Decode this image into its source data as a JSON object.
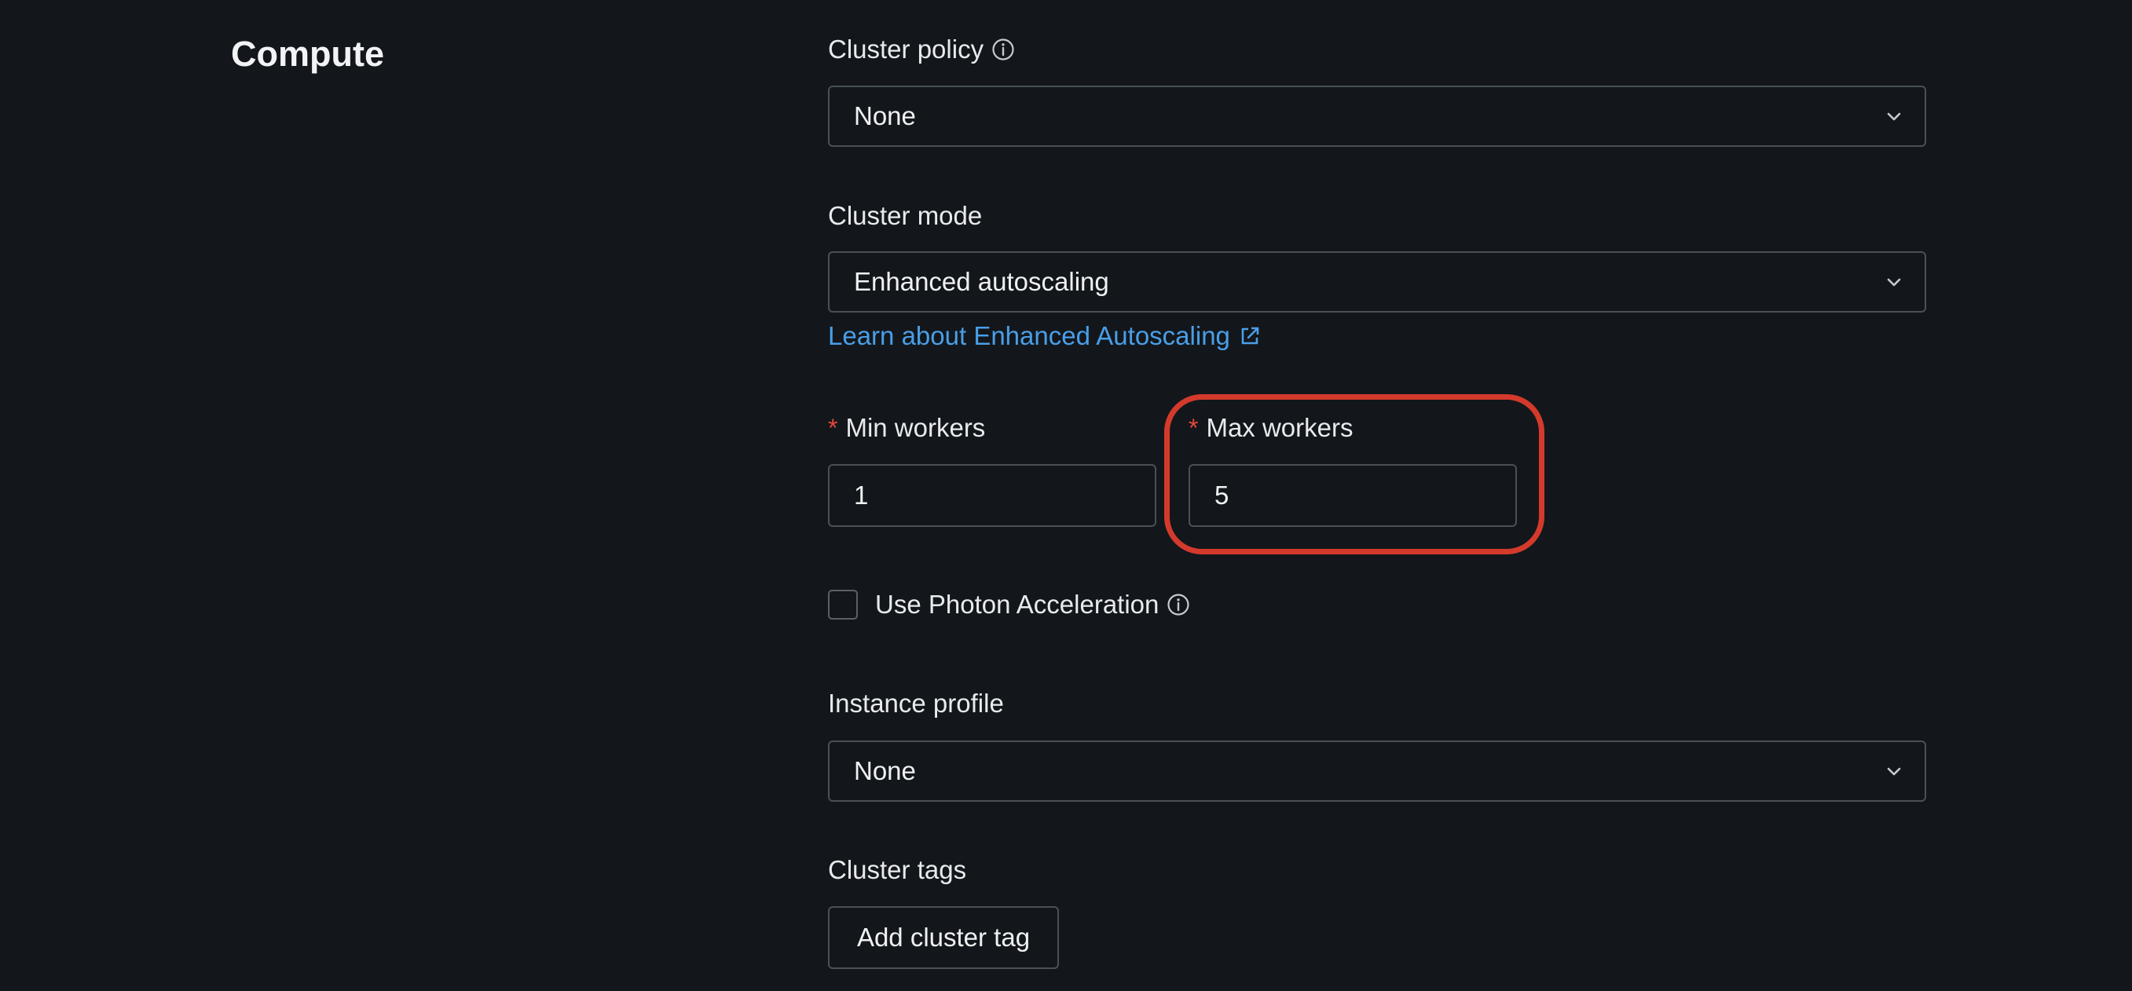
{
  "section": {
    "title": "Compute"
  },
  "cluster_policy": {
    "label": "Cluster policy",
    "value": "None"
  },
  "cluster_mode": {
    "label": "Cluster mode",
    "value": "Enhanced autoscaling",
    "link_text": "Learn about Enhanced Autoscaling"
  },
  "workers": {
    "required_marker": "*",
    "min_label": "Min workers",
    "min_value": "1",
    "max_label": "Max workers",
    "max_value": "5"
  },
  "photon": {
    "label": "Use Photon Acceleration",
    "checked": false
  },
  "instance_profile": {
    "label": "Instance profile",
    "value": "None"
  },
  "cluster_tags": {
    "label": "Cluster tags",
    "button_label": "Add cluster tag"
  },
  "icons": {
    "info": "info-icon",
    "chevron": "chevron-down-icon",
    "external": "external-link-icon"
  },
  "colors": {
    "background": "#13171b",
    "link": "#4a9ee8",
    "required": "#e5483b",
    "highlight": "#d43a2c",
    "border": "#4a5058"
  }
}
